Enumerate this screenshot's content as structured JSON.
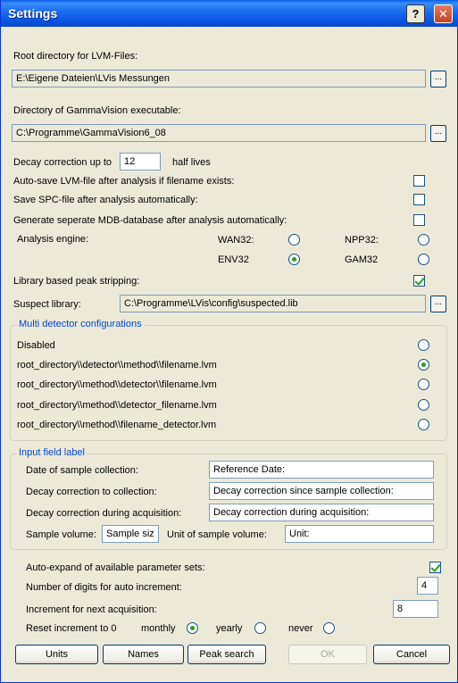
{
  "window": {
    "title": "Settings",
    "help_label": "?",
    "close_label": "✕"
  },
  "root_dir": {
    "label": "Root directory for LVM-Files:",
    "value": "E:\\Eigene Dateien\\LVis Messungen",
    "browse_label": "..."
  },
  "gamma_dir": {
    "label": "Directory of GammaVision executable:",
    "value": "C:\\Programme\\GammaVision6_08",
    "browse_label": "..."
  },
  "decay": {
    "label_pre": "Decay correction up to",
    "value": "12",
    "label_post": "half lives"
  },
  "autosave": {
    "label": "Auto-save LVM-file after analysis if filename exists:",
    "checked": false
  },
  "save_spc": {
    "label": "Save SPC-file after analysis automatically:",
    "checked": false
  },
  "mdb": {
    "label": "Generate seperate MDB-database after analysis automatically:",
    "checked": false
  },
  "engine": {
    "label": "Analysis engine:",
    "options": [
      {
        "label": "WAN32:",
        "selected": false
      },
      {
        "label": "NPP32:",
        "selected": false
      },
      {
        "label": "ENV32",
        "selected": true
      },
      {
        "label": "GAM32",
        "selected": false
      }
    ]
  },
  "peak_strip": {
    "label": "Library based peak stripping:",
    "checked": true
  },
  "suspect": {
    "label": "Suspect library:",
    "value": "C:\\Programme\\LVis\\config\\suspected.lib",
    "browse_label": "..."
  },
  "multi": {
    "title": "Multi detector configurations",
    "options": [
      {
        "label": "Disabled",
        "selected": false
      },
      {
        "label": "root_directory\\\\detector\\\\method\\\\filename.lvm",
        "selected": true
      },
      {
        "label": "root_directory\\\\method\\\\detector\\\\filename.lvm",
        "selected": false
      },
      {
        "label": "root_directory\\\\method\\\\detector_filename.lvm",
        "selected": false
      },
      {
        "label": "root_directory\\\\method\\\\filename_detector.lvm",
        "selected": false
      }
    ]
  },
  "input_labels": {
    "title": "Input field label",
    "date_label": "Date of sample collection:",
    "date_value": "Reference Date:",
    "decay_coll_label": "Decay correction to collection:",
    "decay_coll_value": "Decay correction since sample collection:",
    "decay_acq_label": "Decay correction during acquisition:",
    "decay_acq_value": "Decay correction during acquisition:",
    "volume_label": "Sample volume:",
    "volume_value": "Sample siz",
    "unit_label": "Unit of sample volume:",
    "unit_value": "Unit:"
  },
  "autoexpand": {
    "label": "Auto-expand of available parameter sets:",
    "checked": true
  },
  "digits": {
    "label": "Number of digits for auto increment:",
    "value": "4"
  },
  "increment": {
    "label": "Increment for next acquisition:",
    "value": "8"
  },
  "reset": {
    "label": "Reset increment to 0",
    "options": [
      {
        "label": "monthly",
        "selected": true
      },
      {
        "label": "yearly",
        "selected": false
      },
      {
        "label": "never",
        "selected": false
      }
    ]
  },
  "buttons": {
    "units": "Units",
    "names": "Names",
    "peak_search": "Peak search",
    "ok": "OK",
    "cancel": "Cancel"
  }
}
